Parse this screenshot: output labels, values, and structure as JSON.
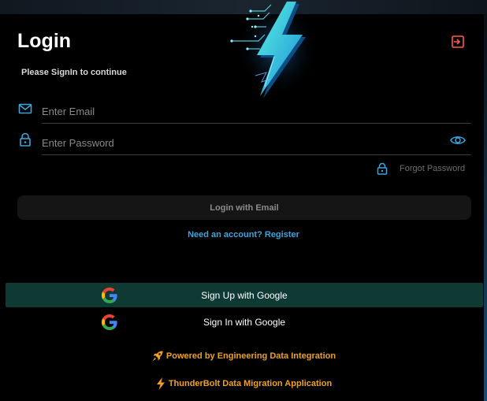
{
  "header": {
    "title": "Login",
    "subtitle": "Please SignIn to continue"
  },
  "form": {
    "email_placeholder": "Enter Email",
    "password_placeholder": "Enter Password",
    "forgot_password": "Forgot Password",
    "login_button": "Login with Email",
    "register_link": "Need an account? Register"
  },
  "social": {
    "google_signup": "Sign Up with Google",
    "google_signin": "Sign In with Google"
  },
  "footer": {
    "powered_by": "Powered by Engineering Data Integration",
    "app_name": "ThunderBolt Data Migration Application"
  },
  "colors": {
    "accent_blue": "#3aa6df",
    "accent_orange": "#f0a020",
    "exit_icon": "#ff5a4a",
    "google_signup_bg": "#0f3a34"
  },
  "icons": [
    "thunderbolt-logo-icon",
    "exit-icon",
    "mail-icon",
    "lock-icon",
    "eye-icon",
    "google-icon",
    "rocket-icon",
    "bolt-icon"
  ]
}
